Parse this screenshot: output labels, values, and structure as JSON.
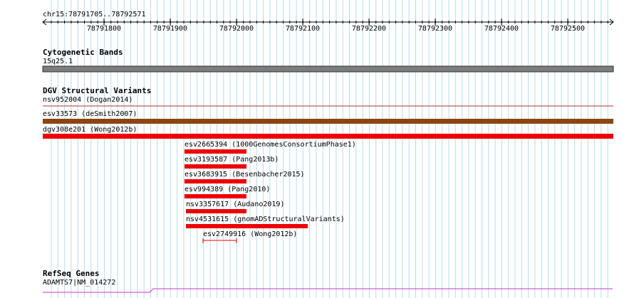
{
  "ruler": {
    "region": "chr15:78791705..78792571",
    "ticks": [
      "78791800",
      "78791900",
      "78792000",
      "78792100",
      "78792200",
      "78792300",
      "78792400",
      "78792500"
    ]
  },
  "tracks": {
    "cytoband": {
      "title": "Cytogenetic Bands",
      "band": "15q25.1"
    },
    "dgv": {
      "title": "DGV Structural Variants",
      "features": [
        {
          "label": "nsv952004 (Dogan2014)",
          "color": "#8b1a1a"
        },
        {
          "label": "esv33573 (deSmith2007)",
          "color": "#8b4513"
        },
        {
          "label": "dgv308e201 (Wong2012b)",
          "color": "#ee0000"
        },
        {
          "label": "esv2665394 (1000GenomesConsortiumPhase1)",
          "color": "#ee0000"
        },
        {
          "label": "esv3193587 (Pang2013b)",
          "color": "#ee0000"
        },
        {
          "label": "esv3683915 (Besenbacher2015)",
          "color": "#ee0000"
        },
        {
          "label": "esv994389 (Pang2010)",
          "color": "#ee0000"
        },
        {
          "label": "nsv3357617 (Audano2019)",
          "color": "#ee0000"
        },
        {
          "label": "nsv4531615 (gnomADStructuralVariants)",
          "color": "#ee0000"
        },
        {
          "label": "esv2749916 (Wong2012b)",
          "color": "#ee0000"
        }
      ]
    },
    "refseq": {
      "title": "RefSeq Genes",
      "gene": "ADAMTS7|NM_014272",
      "color": "#cc33cc"
    }
  }
}
